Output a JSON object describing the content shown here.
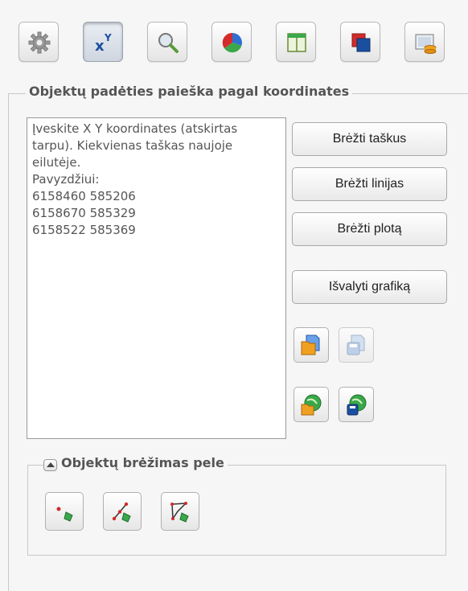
{
  "toolbar": {
    "buttons": [
      {
        "icon": "gear-icon",
        "active": false
      },
      {
        "icon": "xy-coordinates-icon",
        "active": true,
        "label": "x",
        "superscript": "Y"
      },
      {
        "icon": "magnifier-icon",
        "active": false
      },
      {
        "icon": "pie-chart-icon",
        "active": false
      },
      {
        "icon": "table-icon",
        "active": false
      },
      {
        "icon": "layers-icon",
        "active": false
      },
      {
        "icon": "map-database-icon",
        "active": false
      }
    ]
  },
  "coordinate_search": {
    "legend": "Objektų padėties paieška pagal koordinates",
    "textarea_placeholder": "Įveskite X Y koordinates (atskirtas tarpu). Kiekvienas taškas naujoje eilutėje.\nPavyzdžiui:\n6158460 585206\n6158670 585329\n6158522 585369",
    "buttons": {
      "draw_points": "Brėžti taškus",
      "draw_lines": "Brėžti linijas",
      "draw_area": "Brėžti plotą",
      "clear_graphics": "Išvalyti grafiką"
    },
    "file_buttons": [
      {
        "icon": "open-file-icon",
        "enabled": true
      },
      {
        "icon": "save-file-icon",
        "enabled": false
      },
      {
        "icon": "load-from-web-icon",
        "enabled": true
      },
      {
        "icon": "save-to-web-icon",
        "enabled": true
      }
    ]
  },
  "mouse_drawing": {
    "legend": "Objektų brėžimas pele",
    "collapse_icon": "collapse-up-icon",
    "tools": [
      {
        "icon": "draw-point-icon"
      },
      {
        "icon": "draw-line-icon"
      },
      {
        "icon": "draw-polygon-icon"
      }
    ]
  },
  "colors": {
    "background": "#f6f6f6",
    "border": "#c8c8c8",
    "accent_blue": "#1a4fa0",
    "accent_green": "#3aa84a",
    "accent_red": "#d42a2a",
    "accent_orange": "#f0a020"
  }
}
